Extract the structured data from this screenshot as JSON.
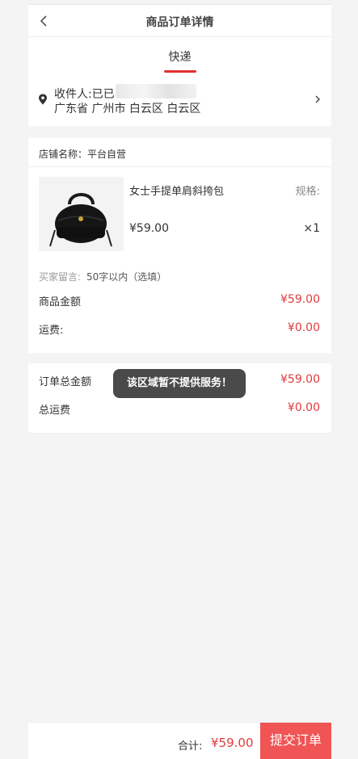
{
  "header": {
    "title": "商品订单详情"
  },
  "tabs": [
    {
      "label": "快递"
    }
  ],
  "address": {
    "recipient": "收件人:已已",
    "line": "广东省 广州市 白云区 白云区"
  },
  "shop": {
    "label": "店铺名称：平台自营",
    "product": {
      "name": "女士手提单肩斜挎包",
      "spec_label": "规格:",
      "price": "¥59.00",
      "quantity": "×1"
    },
    "message_label": "买家留言:",
    "message_placeholder": "50字以内（选填）",
    "goods_amount_label": "商品金额",
    "goods_amount_value": "¥59.00",
    "shipping_label": "运费:",
    "shipping_value": "¥0.00"
  },
  "summary": {
    "order_total_label": "订单总金额",
    "order_total_value": "¥59.00",
    "total_shipping_label": "总运费",
    "total_shipping_value": "¥0.00"
  },
  "toast": {
    "text": "该区域暂不提供服务！"
  },
  "bottom": {
    "total_label": "合计:",
    "total_value": "¥59.00",
    "submit_label": "提交订单"
  },
  "colors": {
    "accent": "#e03b3b",
    "button": "#f05454"
  }
}
